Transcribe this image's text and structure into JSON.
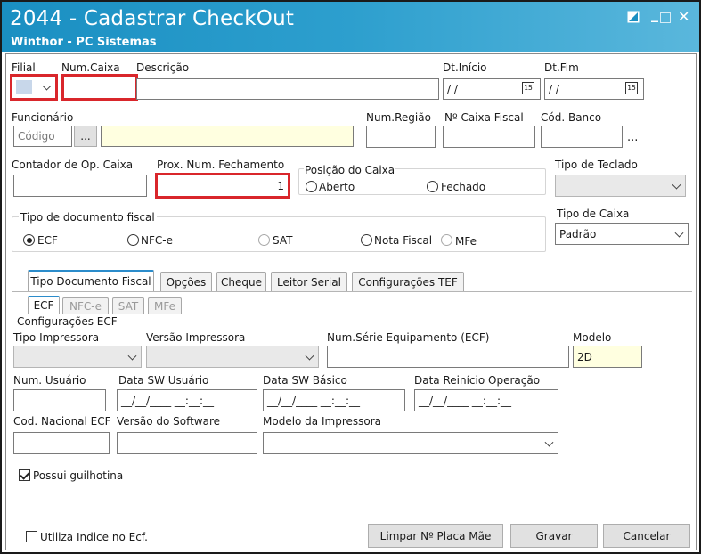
{
  "window": {
    "title": "2044 - Cadastrar CheckOut",
    "subtitle": "Winthor - PC Sistemas",
    "minimize": "_",
    "close": "✕"
  },
  "top": {
    "filial_label": "Filial",
    "numcaixa_label": "Num.Caixa",
    "descricao_label": "Descrição",
    "dtinicio_label": "Dt.Início",
    "dtinicio_value": "/ /",
    "dtfim_label": "Dt.Fim",
    "dtfim_value": "/ /",
    "cal_glyph": "15"
  },
  "funcionario": {
    "label": "Funcionário",
    "codigo_placeholder": "Código",
    "lookup_label": "...",
    "numregiao_label": "Num.Região",
    "caixafiscal_label": "Nº Caixa Fiscal",
    "codbanco_label": "Cód. Banco",
    "codbanco_more": "..."
  },
  "row3": {
    "contador_label": "Contador de Op. Caixa",
    "proxnum_label": "Prox. Num. Fechamento",
    "proxnum_value": "1",
    "posicao_label": "Posição do Caixa",
    "aberto_label": "Aberto",
    "fechado_label": "Fechado",
    "teclado_label": "Tipo de Teclado"
  },
  "docfiscal": {
    "label": "Tipo de documento fiscal",
    "options": [
      "ECF",
      "NFC-e",
      "SAT",
      "Nota Fiscal",
      "MFe"
    ],
    "selected": "ECF"
  },
  "tipocaixa": {
    "label": "Tipo de Caixa",
    "value": "Padrão"
  },
  "tabs": [
    "Tipo Documento Fiscal",
    "Opções",
    "Cheque",
    "Leitor Serial",
    "Configurações TEF"
  ],
  "subtabs": [
    "ECF",
    "NFC-e",
    "SAT",
    "MFe"
  ],
  "ecf": {
    "section_label": "Configurações ECF",
    "tipo_impressora_label": "Tipo Impressora",
    "versao_impressora_label": "Versão Impressora",
    "numserie_label": "Num.Série Equipamento (ECF)",
    "modelo_label": "Modelo",
    "modelo_value": "2D",
    "numusuario_label": "Num. Usuário",
    "datasw_usuario_label": "Data  SW Usuário",
    "datasw_usuario_value": "__/__/____ __:__:__",
    "datasw_basico_label": "Data SW Básico",
    "datasw_basico_value": "__/__/____ __:__:__",
    "datareinicio_label": "Data Reinício Operação",
    "datareinicio_value": "__/__/____ __:__:__",
    "codnacional_label": "Cod. Nacional ECF",
    "versaosoftware_label": "Versão do Software",
    "modeloimpressora_label": "Modelo da Impressora",
    "guilhotina_label": "Possui guilhotina"
  },
  "footer": {
    "utiliza_indice_label": "Utiliza Indice no Ecf.",
    "limpar_label": "Limpar Nº Placa Mãe",
    "gravar_label": "Gravar",
    "cancelar_label": "Cancelar"
  },
  "colors": {
    "titlebar": "#1a8fc2",
    "highlight": "#d9262b",
    "yellow_field": "#ffffe0",
    "active_tab": "#2b8ccb"
  }
}
